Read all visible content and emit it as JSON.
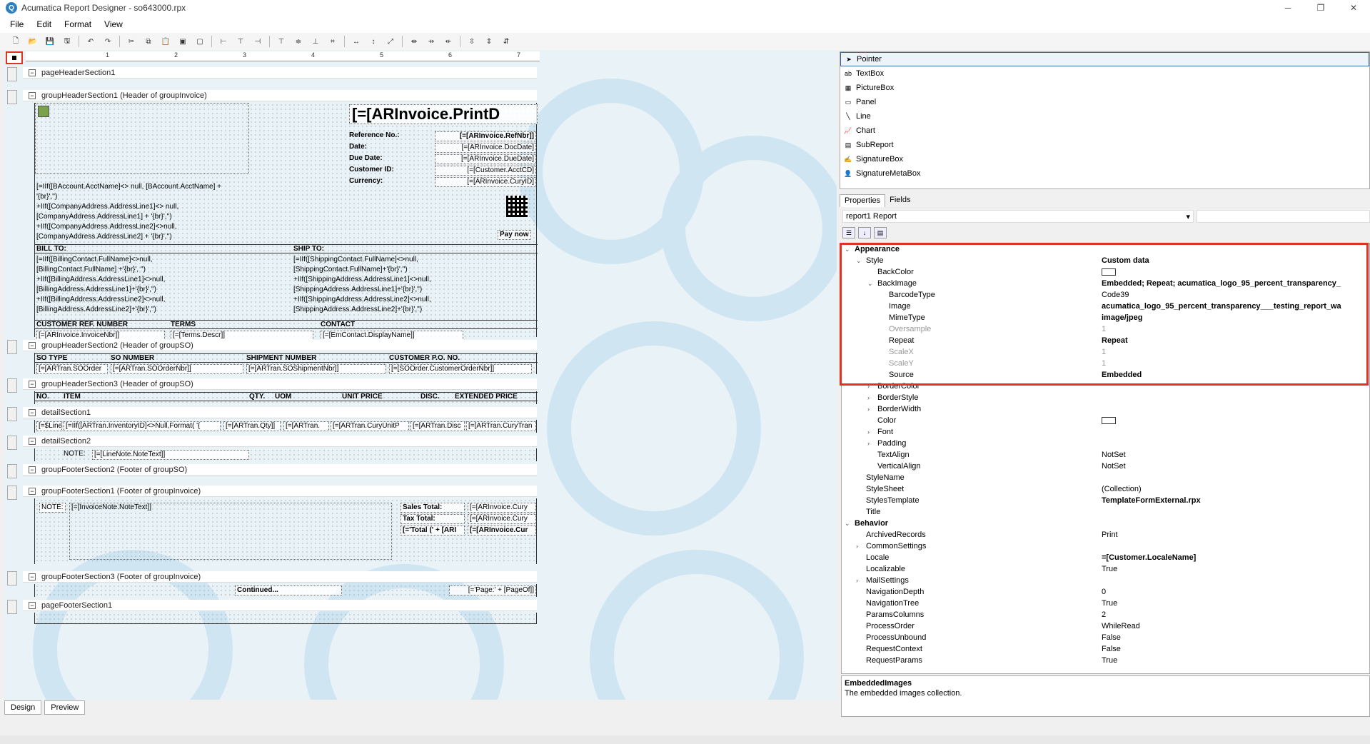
{
  "window": {
    "title": "Acumatica Report Designer - so643000.rpx"
  },
  "menu": [
    "File",
    "Edit",
    "Format",
    "View"
  ],
  "ruler_ticks": [
    "1",
    "2",
    "3",
    "4",
    "5",
    "6",
    "7"
  ],
  "bands": {
    "pageHeader": "pageHeaderSection1",
    "groupHeader1": "groupHeaderSection1 (Header of groupInvoice)",
    "groupHeader2": "groupHeaderSection2 (Header of groupSO)",
    "groupHeader3": "groupHeaderSection3 (Header of groupSO)",
    "detail1": "detailSection1",
    "detail2": "detailSection2",
    "groupFooter2": "groupFooterSection2 (Footer of groupSO)",
    "groupFooter1": "groupFooterSection1 (Footer of groupInvoice)",
    "groupFooter3": "groupFooterSection3 (Footer of groupInvoice)",
    "pageFooter": "pageFooterSection1"
  },
  "header": {
    "print_title": "[=[ARInvoice.PrintD",
    "ref_label": "Reference No.:",
    "ref_value": "[=[ARInvoice.RefNbr]]",
    "date_label": "Date:",
    "date_value": "[=[ARInvoice.DocDate]",
    "due_label": "Due Date:",
    "due_value": "[=[ARInvoice.DueDate]",
    "cust_label": "Customer ID:",
    "cust_value": "[=[Customer.AcctCD]",
    "cur_label": "Currency:",
    "cur_value": "[=[ARInvoice.CuryID]",
    "pay_now": "Pay now",
    "addr_lines": [
      "[=IIf([BAccount.AcctName]<> null, [BAccount.AcctName] +",
      "'{br}','')",
      "+IIf([CompanyAddress.AddressLine1]<> null,",
      "[CompanyAddress.AddressLine1] + '{br}','')",
      "+IIf([CompanyAddress.AddressLine2]<>null,",
      "[CompanyAddress.AddressLine2] + '{br}','')"
    ],
    "bill_to": "BILL TO:",
    "ship_to": "SHIP TO:",
    "bill_lines": [
      "[=IIf([BillingContact.FullName]<>null,",
      "[BillingContact.FullName] +'{br}', '')",
      "+IIf([BillingAddress.AddressLine1]<>null,",
      "[BillingAddress.AddressLine1]+'{br}','')",
      "+IIf([BillingAddress.AddressLine2]<>null,",
      "[BillingAddress.AddressLine2]+'{br}','')"
    ],
    "ship_lines": [
      "[=IIf([ShippingContact.FullName]<>null,",
      "[ShippingContact.FullName]+'{br}','')",
      "+IIf([ShippingAddress.AddressLine1]<>null,",
      "[ShippingAddress.AddressLine1]+'{br}','')",
      "+IIf([ShippingAddress.AddressLine2]<>null,",
      "[ShippingAddress.AddressLine2]+'{br}','')"
    ],
    "col_custref": "CUSTOMER REF. NUMBER",
    "col_terms": "TERMS",
    "col_contact": "CONTACT",
    "val_custref": "[=[ARInvoice.InvoiceNbr]]",
    "val_terms": "[=[Terms.Descr]]",
    "val_contact": "[=[EmContact.DisplayName]]"
  },
  "so": {
    "col_type": "SO TYPE",
    "col_number": "SO NUMBER",
    "col_ship": "SHIPMENT NUMBER",
    "col_po": "CUSTOMER P.O. NO.",
    "val_type": "[=[ARTran.SOOrder",
    "val_number": "[=[ARTran.SOOrderNbr]]",
    "val_ship": "[=[ARTran.SOShipmentNbr]]",
    "val_po": "[=[SOOrder.CustomerOrderNbr]]"
  },
  "lines": {
    "cols": [
      "NO.",
      "ITEM",
      "QTY.",
      "UOM",
      "UNIT PRICE",
      "DISC.",
      "EXTENDED PRICE"
    ],
    "vals": [
      "[=$Line]",
      "[=IIf([ARTran.InventoryID]<>Null,Format( '{",
      "[=[ARTran.Qty]]",
      "[=[ARTran.",
      "[=[ARTran.CuryUnitP",
      "[=[ARTran.Disc",
      "[=[ARTran.CuryTran"
    ],
    "note_label": "NOTE:",
    "note_value": "[=[LineNote.NoteText]]"
  },
  "footer": {
    "note_label": "NOTE:",
    "note_value": "[=[InvoiceNote.NoteText]]",
    "sales_label": "Sales Total:",
    "sales_value": "[=[ARInvoice.Cury",
    "tax_label": "Tax Total:",
    "tax_value": "[=[ARInvoice.Cury",
    "total_label": "[='Total (' + [ARI",
    "total_value": "[=[ARInvoice.Cur",
    "continued": "Continued...",
    "page": "[='Page:' + [PageOf]]"
  },
  "bottom_tabs": [
    "Design",
    "Preview"
  ],
  "toolbox": [
    "Pointer",
    "TextBox",
    "PictureBox",
    "Panel",
    "Line",
    "Chart",
    "SubReport",
    "SignatureBox",
    "SignatureMetaBox"
  ],
  "prop_tabs": [
    "Properties",
    "Fields"
  ],
  "prop_object": "report1  Report",
  "properties": [
    {
      "name": "Appearance",
      "value": "",
      "cat": true,
      "indent": 0,
      "exp": "v"
    },
    {
      "name": "Style",
      "value": "Custom data",
      "indent": 1,
      "exp": "v",
      "bold": true
    },
    {
      "name": "BackColor",
      "value": "",
      "indent": 2,
      "swatch": true
    },
    {
      "name": "BackImage",
      "value": "Embedded; Repeat; acumatica_logo_95_percent_transparency_",
      "indent": 2,
      "exp": "v",
      "bold": true
    },
    {
      "name": "BarcodeType",
      "value": "Code39",
      "indent": 3
    },
    {
      "name": "Image",
      "value": "acumatica_logo_95_percent_transparency___testing_report_wa",
      "indent": 3,
      "bold": true
    },
    {
      "name": "MimeType",
      "value": "image/jpeg",
      "indent": 3,
      "bold": true
    },
    {
      "name": "Oversample",
      "value": "1",
      "indent": 3,
      "grey": true
    },
    {
      "name": "Repeat",
      "value": "Repeat",
      "indent": 3,
      "bold": true
    },
    {
      "name": "ScaleX",
      "value": "1",
      "indent": 3,
      "grey": true
    },
    {
      "name": "ScaleY",
      "value": "1",
      "indent": 3,
      "grey": true
    },
    {
      "name": "Source",
      "value": "Embedded",
      "indent": 3,
      "bold": true
    },
    {
      "name": "BorderColor",
      "value": "",
      "indent": 2,
      "exp": ">"
    },
    {
      "name": "BorderStyle",
      "value": "",
      "indent": 2,
      "exp": ">"
    },
    {
      "name": "BorderWidth",
      "value": "",
      "indent": 2,
      "exp": ">"
    },
    {
      "name": "Color",
      "value": "",
      "indent": 2,
      "swatch": true
    },
    {
      "name": "Font",
      "value": "",
      "indent": 2,
      "exp": ">"
    },
    {
      "name": "Padding",
      "value": "",
      "indent": 2,
      "exp": ">"
    },
    {
      "name": "TextAlign",
      "value": "NotSet",
      "indent": 2
    },
    {
      "name": "VerticalAlign",
      "value": "NotSet",
      "indent": 2
    },
    {
      "name": "StyleName",
      "value": "",
      "indent": 1
    },
    {
      "name": "StyleSheet",
      "value": "(Collection)",
      "indent": 1
    },
    {
      "name": "StylesTemplate",
      "value": "TemplateFormExternal.rpx",
      "indent": 1,
      "bold": true
    },
    {
      "name": "Title",
      "value": "",
      "indent": 1
    },
    {
      "name": "Behavior",
      "value": "",
      "cat": true,
      "indent": 0,
      "exp": "v"
    },
    {
      "name": "ArchivedRecords",
      "value": "Print",
      "indent": 1
    },
    {
      "name": "CommonSettings",
      "value": "",
      "indent": 1,
      "exp": ">"
    },
    {
      "name": "Locale",
      "value": "=[Customer.LocaleName]",
      "indent": 1,
      "bold": true
    },
    {
      "name": "Localizable",
      "value": "True",
      "indent": 1
    },
    {
      "name": "MailSettings",
      "value": "",
      "indent": 1,
      "exp": ">"
    },
    {
      "name": "NavigationDepth",
      "value": "0",
      "indent": 1
    },
    {
      "name": "NavigationTree",
      "value": "True",
      "indent": 1
    },
    {
      "name": "ParamsColumns",
      "value": "2",
      "indent": 1
    },
    {
      "name": "ProcessOrder",
      "value": "WhileRead",
      "indent": 1
    },
    {
      "name": "ProcessUnbound",
      "value": "False",
      "indent": 1
    },
    {
      "name": "RequestContext",
      "value": "False",
      "indent": 1
    },
    {
      "name": "RequestParams",
      "value": "True",
      "indent": 1
    }
  ],
  "description": {
    "title": "EmbeddedImages",
    "text": "The embedded images collection."
  }
}
